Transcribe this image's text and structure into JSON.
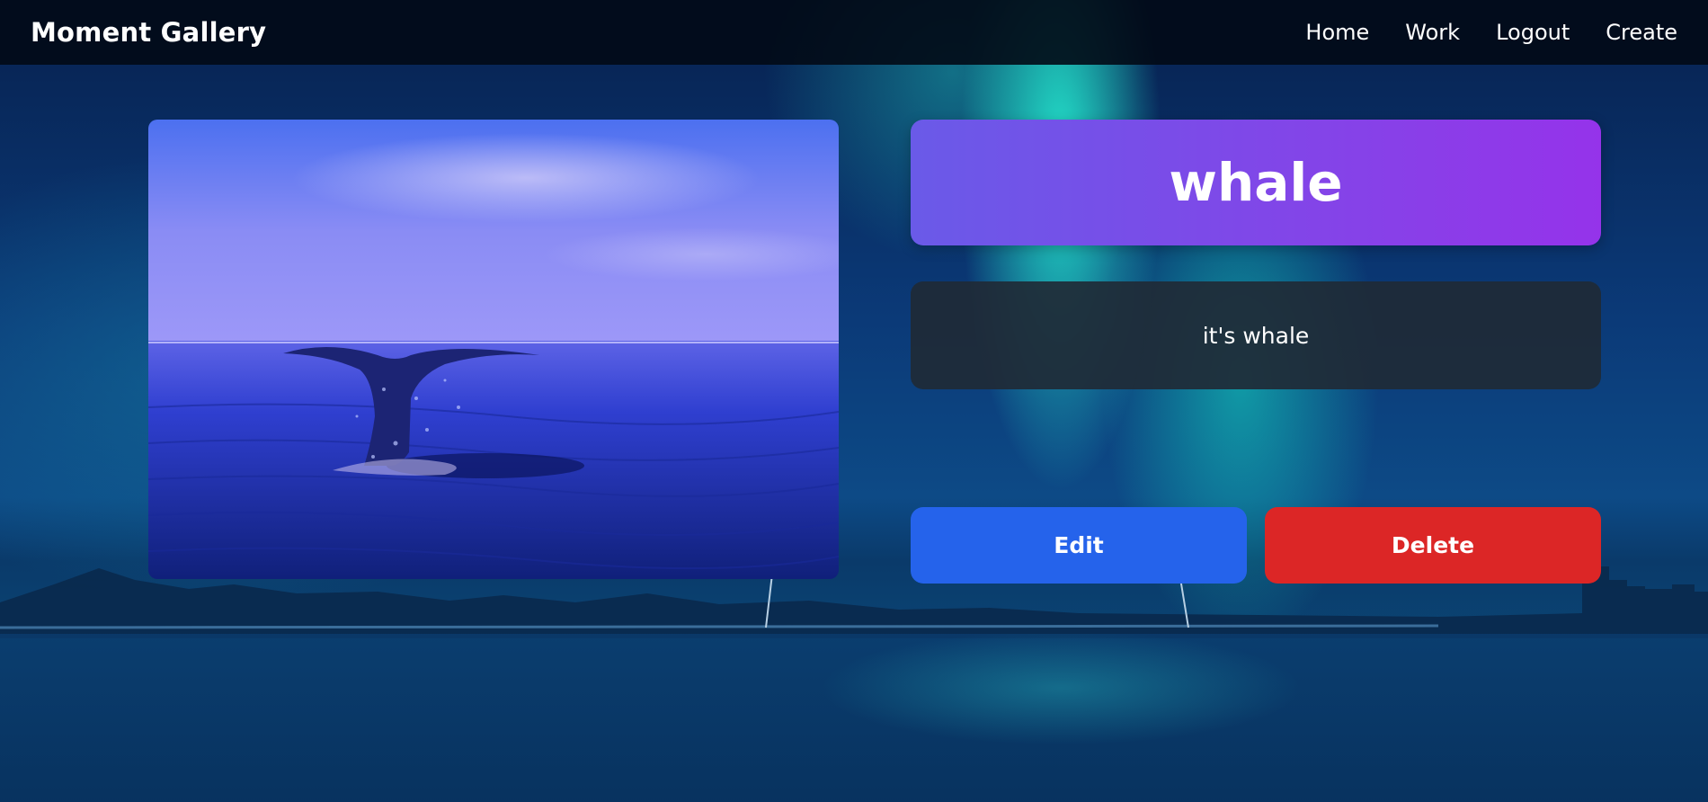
{
  "navbar": {
    "brand": "Moment Gallery",
    "links": [
      "Home",
      "Work",
      "Logout",
      "Create"
    ]
  },
  "work": {
    "title": "whale",
    "description": "it's whale"
  },
  "actions": {
    "edit_label": "Edit",
    "delete_label": "Delete"
  },
  "colors": {
    "title_card_start": "#6a5ae8",
    "title_card_end": "#9533ea",
    "edit_button": "#2563eb",
    "delete_button": "#dc2626",
    "description_card": "#202a36"
  },
  "image": {
    "subject": "whale-tail-photo"
  }
}
